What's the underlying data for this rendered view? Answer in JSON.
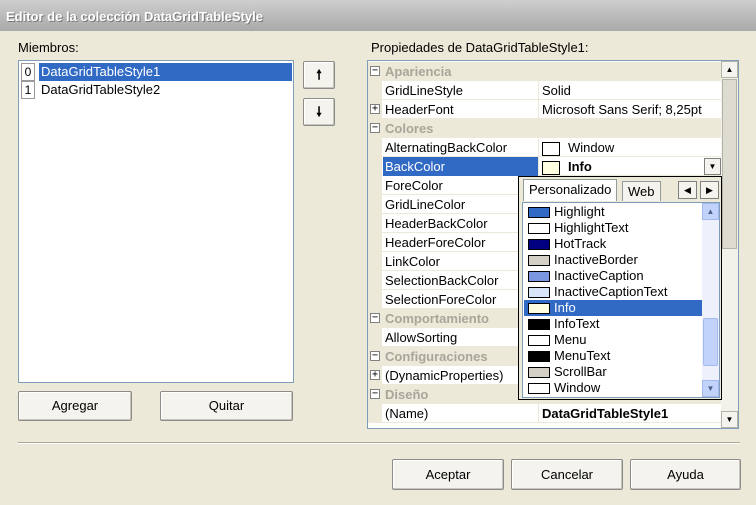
{
  "window": {
    "title": "Editor de la colección DataGridTableStyle"
  },
  "members": {
    "label": "Miembros:",
    "items": [
      {
        "index": "0",
        "name": "DataGridTableStyle1",
        "selected": true
      },
      {
        "index": "1",
        "name": "DataGridTableStyle2",
        "selected": false
      }
    ],
    "move_up_icon": "arrow-up-icon",
    "move_down_icon": "arrow-down-icon",
    "add_label": "Agregar",
    "remove_label": "Quitar"
  },
  "properties": {
    "label": "Propiedades de DataGridTableStyle1:",
    "rows": [
      {
        "type": "category",
        "expander": "⊟",
        "name": "Apariencia"
      },
      {
        "type": "prop",
        "name": "GridLineStyle",
        "value": "Solid"
      },
      {
        "type": "prop",
        "expander": "+",
        "name": "HeaderFont",
        "value": "Microsoft Sans Serif; 8,25pt"
      },
      {
        "type": "category",
        "expander": "⊟",
        "name": "Colores"
      },
      {
        "type": "prop",
        "name": "AlternatingBackColor",
        "value": "Window",
        "swatch": "#ffffff"
      },
      {
        "type": "prop",
        "name": "BackColor",
        "value": "Info",
        "swatch": "#ffffe1",
        "selected": true,
        "bold": true
      },
      {
        "type": "prop",
        "name": "ForeColor",
        "value": ""
      },
      {
        "type": "prop",
        "name": "GridLineColor",
        "value": ""
      },
      {
        "type": "prop",
        "name": "HeaderBackColor",
        "value": ""
      },
      {
        "type": "prop",
        "name": "HeaderForeColor",
        "value": ""
      },
      {
        "type": "prop",
        "name": "LinkColor",
        "value": ""
      },
      {
        "type": "prop",
        "name": "SelectionBackColor",
        "value": ""
      },
      {
        "type": "prop",
        "name": "SelectionForeColor",
        "value": ""
      },
      {
        "type": "category",
        "expander": "⊟",
        "name": "Comportamiento"
      },
      {
        "type": "prop",
        "name": "AllowSorting",
        "value": ""
      },
      {
        "type": "category",
        "expander": "⊟",
        "name": "Configuraciones"
      },
      {
        "type": "prop",
        "expander": "+",
        "name": "(DynamicProperties)",
        "value": ""
      },
      {
        "type": "category",
        "expander": "⊟",
        "name": "Diseño"
      },
      {
        "type": "prop",
        "name": "(Name)",
        "value": "DataGridTableStyle1",
        "bold": true
      }
    ]
  },
  "color_picker": {
    "tabs": [
      "Personalizado",
      "Web"
    ],
    "active_tab": "Personalizado",
    "colors": [
      {
        "name": "Highlight",
        "color": "#316ac5"
      },
      {
        "name": "HighlightText",
        "color": "#ffffff"
      },
      {
        "name": "HotTrack",
        "color": "#000080"
      },
      {
        "name": "InactiveBorder",
        "color": "#d4d0c8"
      },
      {
        "name": "InactiveCaption",
        "color": "#7a96df"
      },
      {
        "name": "InactiveCaptionText",
        "color": "#d8e4f8"
      },
      {
        "name": "Info",
        "color": "#ffffe1",
        "selected": true
      },
      {
        "name": "InfoText",
        "color": "#000000"
      },
      {
        "name": "Menu",
        "color": "#ffffff"
      },
      {
        "name": "MenuText",
        "color": "#000000"
      },
      {
        "name": "ScrollBar",
        "color": "#d4d0c8"
      },
      {
        "name": "Window",
        "color": "#ffffff"
      }
    ]
  },
  "footer": {
    "ok_label": "Aceptar",
    "cancel_label": "Cancelar",
    "help_label": "Ayuda"
  },
  "colors": {
    "selection": "#316ac5",
    "dialog_bg": "#ece9d8",
    "category_text": "#a8a69a"
  }
}
